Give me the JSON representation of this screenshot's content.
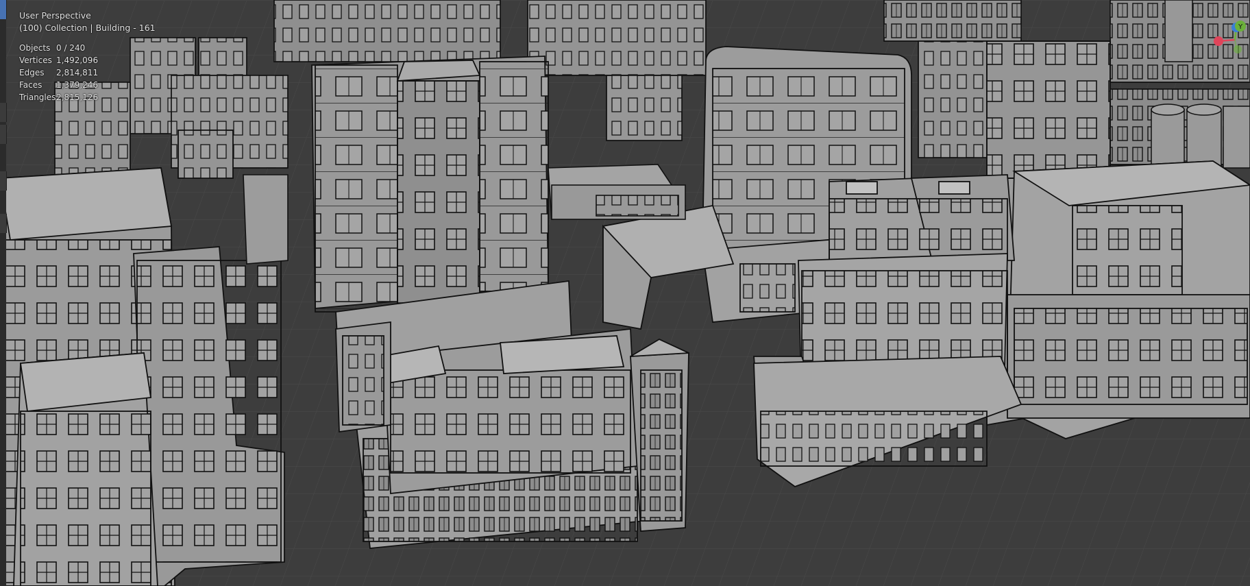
{
  "viewport": {
    "view_name": "User Perspective",
    "collection_info": "(100) Collection | Building - 161"
  },
  "stats": [
    {
      "label": "Objects",
      "value": "0 / 240"
    },
    {
      "label": "Vertices",
      "value": "1,492,096"
    },
    {
      "label": "Edges",
      "value": "2,814,811"
    },
    {
      "label": "Faces",
      "value": "1,379,246"
    },
    {
      "label": "Triangles",
      "value": "2,815,126"
    }
  ],
  "gizmo": {
    "axis_y_label": "Y",
    "x_color": "#e0445a",
    "y_color": "#6bb03a",
    "z_color": "#3b7fd6"
  },
  "colors": {
    "grid_bg": "#3d3d3d",
    "grid_line": "#4a4a4a",
    "building_face": "#9a9a9a",
    "building_edge": "#111111"
  }
}
